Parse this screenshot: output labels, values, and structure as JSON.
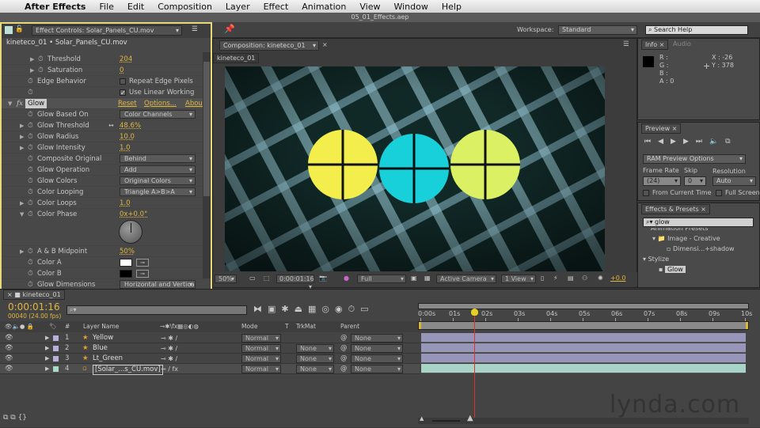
{
  "menubar": {
    "apple": "",
    "app": "After Effects",
    "items": [
      "File",
      "Edit",
      "Composition",
      "Layer",
      "Effect",
      "Animation",
      "View",
      "Window",
      "Help"
    ]
  },
  "window_title": "05_01_Effects.aep",
  "toolbar": {
    "workspace_label": "Workspace:",
    "workspace_value": "Standard",
    "search_placeholder": "Search Help"
  },
  "effect_controls": {
    "tab": "Effect Controls: Solar_Panels_CU.mov",
    "breadcrumb": "kineteco_01 • Solar_Panels_CU.mov",
    "rows": [
      {
        "label": "Threshold",
        "value": "204"
      },
      {
        "label": "Saturation",
        "value": "0"
      },
      {
        "label": "Edge Behavior",
        "checkbox": "Repeat Edge Pixels",
        "checked": false
      },
      {
        "label": "",
        "checkbox": "Use Linear Working",
        "checked": true
      }
    ],
    "effect": {
      "name": "Glow",
      "reset": "Reset",
      "options": "Options...",
      "about": "About..."
    },
    "glow": {
      "based_on": {
        "label": "Glow Based On",
        "value": "Color Channels"
      },
      "threshold": {
        "label": "Glow Threshold",
        "value": "48.6%"
      },
      "radius": {
        "label": "Glow Radius",
        "value": "10.0"
      },
      "intensity": {
        "label": "Glow Intensity",
        "value": "1.0"
      },
      "composite": {
        "label": "Composite Original",
        "value": "Behind"
      },
      "operation": {
        "label": "Glow Operation",
        "value": "Add"
      },
      "colors": {
        "label": "Glow Colors",
        "value": "Original Colors"
      },
      "looping": {
        "label": "Color Looping",
        "value": "Triangle A>B>A"
      },
      "loops": {
        "label": "Color Loops",
        "value": "1.0"
      },
      "phase": {
        "label": "Color Phase",
        "value": "0x+0.0°"
      },
      "midpoint": {
        "label": "A & B Midpoint",
        "value": "50%"
      },
      "color_a": {
        "label": "Color A",
        "color": "#ffffff"
      },
      "color_b": {
        "label": "Color B",
        "color": "#000000"
      },
      "dimensions": {
        "label": "Glow Dimensions",
        "value": "Horizontal and Vertical"
      }
    }
  },
  "composition": {
    "tab": "Composition: kineteco_01",
    "sub_tab": "kineteco_01",
    "circles": [
      {
        "color": "#f3ee4c"
      },
      {
        "color": "#18d0da"
      },
      {
        "color": "#dcf064"
      }
    ],
    "footer": {
      "zoom": "50%",
      "timecode": "0:00:01:16",
      "resolution": "Full",
      "camera": "Active Camera",
      "views": "1 View",
      "exposure": "+0.0"
    }
  },
  "info": {
    "tabs": [
      "Info",
      "Audio"
    ],
    "r": "R :",
    "g": "G :",
    "b": "B :",
    "a": "A : 0",
    "x": "X : -26",
    "y": "Y : 378"
  },
  "preview": {
    "tab": "Preview",
    "ram_options": "RAM Preview Options",
    "frame_rate_label": "Frame Rate",
    "frame_rate": "(24)",
    "skip_label": "Skip",
    "skip": "0",
    "resolution_label": "Resolution",
    "resolution": "Auto",
    "from_current": "From Current Time",
    "full_screen": "Full Screen"
  },
  "effects_presets": {
    "tab": "Effects & Presets",
    "search": "glow",
    "items": [
      "Animation Presets",
      "Image - Creative",
      "Dimensi...+shadow",
      "Stylize",
      "Glow"
    ]
  },
  "timeline": {
    "tab": "kineteco_01",
    "timecode": "0:00:01:16",
    "frames": "00040 (24.00 fps)",
    "columns": {
      "layer_name": "Layer Name",
      "mode": "Mode",
      "t": "T",
      "trkmat": "TrkMat",
      "parent": "Parent"
    },
    "layers": [
      {
        "num": "1",
        "name": "Yellow",
        "mode": "Normal",
        "trkmat": "",
        "parent": "None",
        "label_color": "#b8b0dc"
      },
      {
        "num": "2",
        "name": "Blue",
        "mode": "Normal",
        "trkmat": "None",
        "parent": "None",
        "label_color": "#b8b0dc"
      },
      {
        "num": "3",
        "name": "Lt_Green",
        "mode": "Normal",
        "trkmat": "None",
        "parent": "None",
        "label_color": "#b8b0dc"
      },
      {
        "num": "4",
        "name": "[Solar_...s_CU.mov]",
        "mode": "Normal",
        "trkmat": "None",
        "parent": "None",
        "label_color": "#a8dcc8"
      }
    ],
    "ruler": [
      "0:00s",
      "01s",
      "02s",
      "03s",
      "04s",
      "05s",
      "06s",
      "07s",
      "08s",
      "09s",
      "10s"
    ],
    "current_time_seconds": 1.667,
    "duration_seconds": 10
  },
  "watermark": "lynda.com"
}
